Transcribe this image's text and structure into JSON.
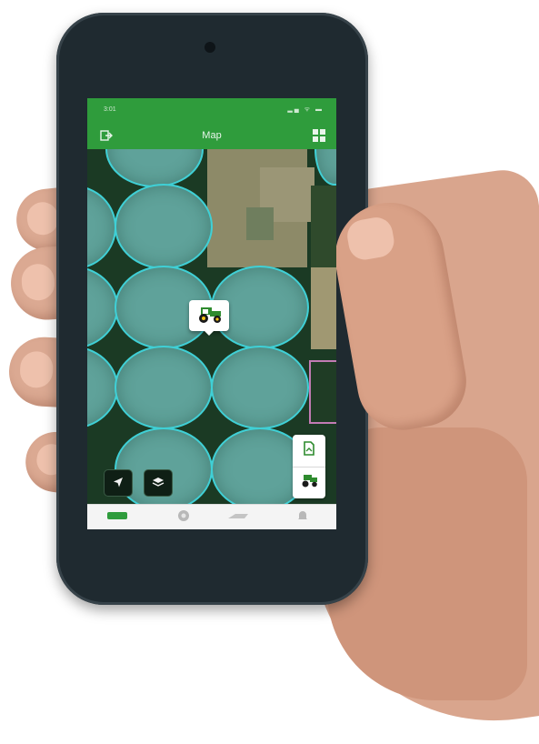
{
  "status_bar": {
    "time": "3:01",
    "icons": "▂▄ ᯤ ▬"
  },
  "app_bar": {
    "title": "Map",
    "left_icon": "exit-icon",
    "right_icon": "grid-icon"
  },
  "map": {
    "marker_icon": "tractor-icon",
    "locate_icon": "navigation-arrow-icon",
    "layers_icon": "layers-icon",
    "side_panel": [
      "field-boundary-icon",
      "tractor-icon"
    ]
  },
  "bottom_nav": {
    "items": [
      "equipment-icon",
      "record-icon",
      "sprayer-icon",
      "notifications-icon"
    ]
  },
  "colors": {
    "app_green": "#2f9c3c",
    "field_outline": "#3fd0d6",
    "field_fill": "#5fa29a",
    "tractor_green": "#2e8b2e",
    "tractor_yellow": "#f2c318"
  }
}
